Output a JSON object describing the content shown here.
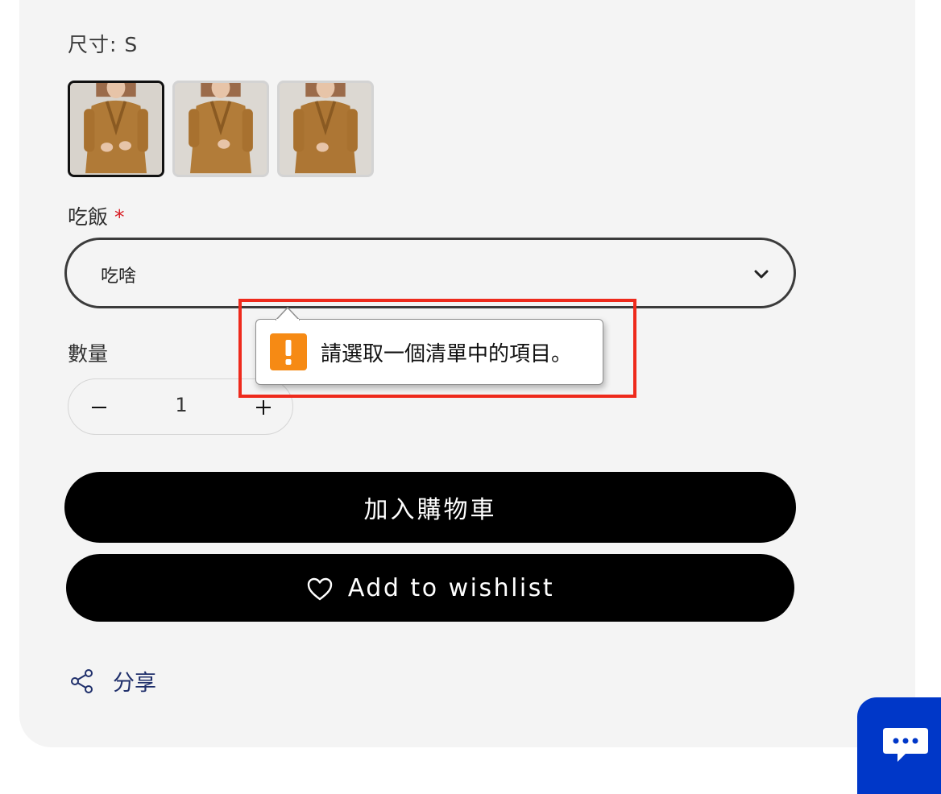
{
  "product": {
    "size_label": "尺寸: S",
    "thumbnails": [
      {
        "name": "dress-front-view",
        "selected": true
      },
      {
        "name": "dress-variant-2",
        "selected": false
      },
      {
        "name": "dress-variant-3",
        "selected": false
      }
    ],
    "option_field": {
      "label": "吃飯",
      "required_mark": "*",
      "selected_value": "吃啥"
    },
    "quantity": {
      "label": "數量",
      "value": "1"
    },
    "add_to_cart_label": "加入購物車",
    "wishlist_label": "Add to wishlist",
    "share_label": "分享"
  },
  "validation_tooltip": {
    "message": "請選取一個清單中的項目。",
    "icon": "warning-icon"
  },
  "colors": {
    "panel_bg": "#f4f4f4",
    "button_bg": "#000000",
    "required": "#d71920",
    "share": "#1f2f6b",
    "highlight": "#ee2a1c",
    "warning": "#f68a14",
    "chat": "#0037c8"
  }
}
